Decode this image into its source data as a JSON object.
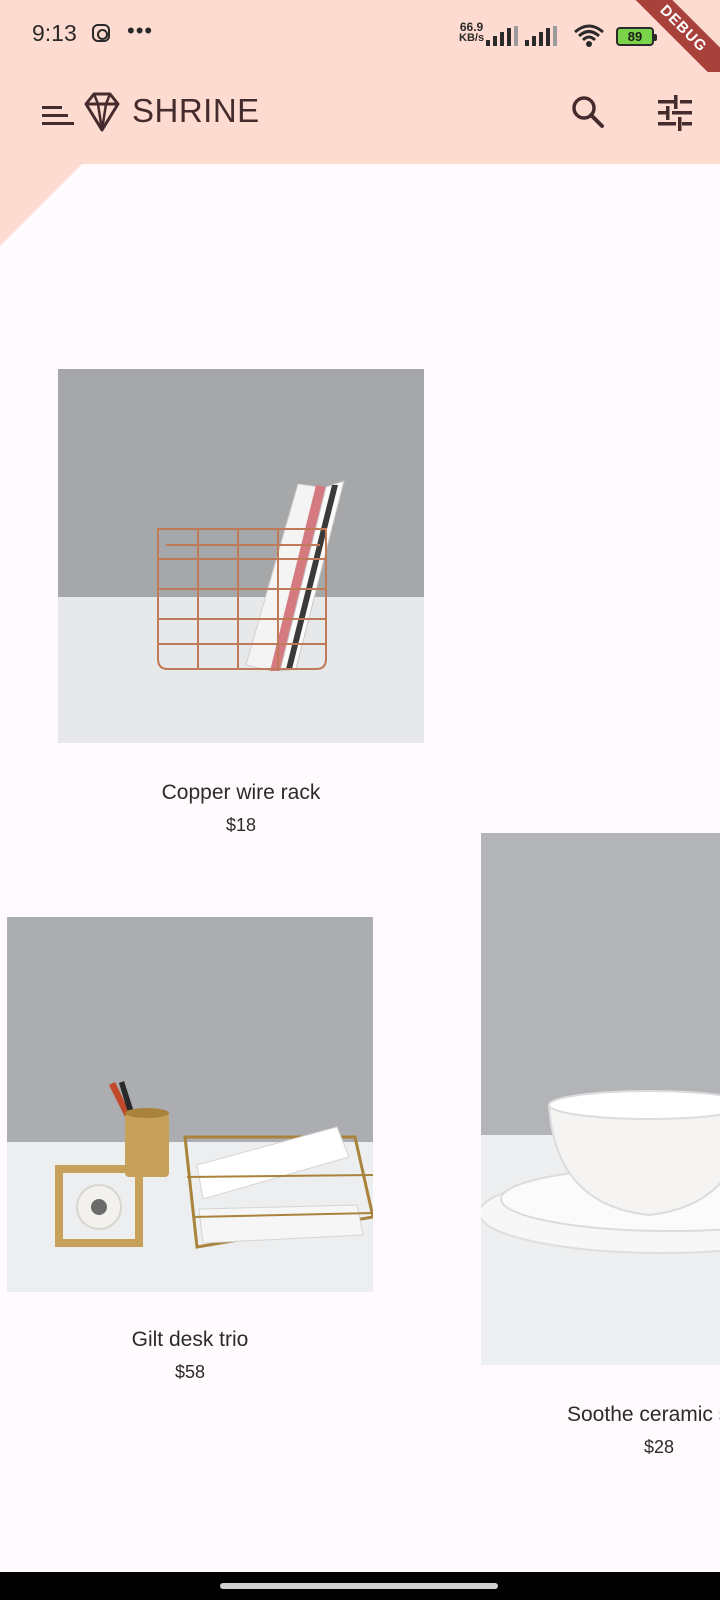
{
  "status": {
    "time": "9:13",
    "speed_value": "66.9",
    "speed_unit": "KB/s",
    "battery": "89"
  },
  "app_bar": {
    "title": "SHRINE"
  },
  "debug_banner": "DEBUG",
  "products": [
    {
      "name": "Copper wire rack",
      "price": "$18"
    },
    {
      "name": "Gilt desk trio",
      "price": "$58"
    },
    {
      "name": "Soothe ceramic set",
      "price": "$28"
    }
  ],
  "colors": {
    "app_bar_bg": "#fedbd0",
    "page_bg": "#fffafd",
    "text": "#442b2d",
    "debug_ribbon": "#a8403b"
  }
}
